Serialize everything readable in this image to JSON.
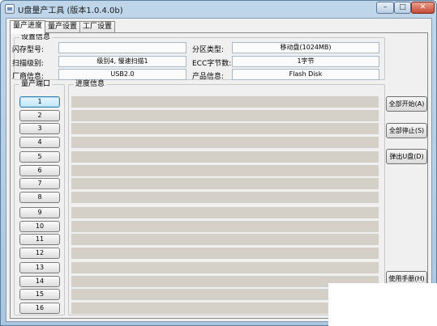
{
  "window": {
    "title": "U盘量产工具 (版本1.0.4.0b)",
    "controls": {
      "minimize": "–",
      "maximize": "□",
      "close": "✕"
    }
  },
  "tabs": [
    {
      "label": "量产进度"
    },
    {
      "label": "量产设置"
    },
    {
      "label": "工厂设置"
    }
  ],
  "settings": {
    "legend": "设置信息",
    "flash_model_label": "闪存型号:",
    "flash_model_value": "",
    "partition_type_label": "分区类型:",
    "partition_type_value": "移动盘(1024MB)",
    "scan_level_label": "扫描级别:",
    "scan_level_value": "级别4, 慢速扫描1",
    "ecc_label": "ECC字节数:",
    "ecc_value": "1字节",
    "vendor_label": "厂商信息:",
    "vendor_value": "USB2.0",
    "product_label": "产品信息:",
    "product_value": "Flash Disk"
  },
  "ports": {
    "legend": "量产端口",
    "items": [
      "1",
      "2",
      "3",
      "4",
      "5",
      "6",
      "7",
      "8",
      "9",
      "10",
      "11",
      "12",
      "13",
      "14",
      "15",
      "16"
    ],
    "active_index": 0
  },
  "progress": {
    "legend": "进度信息"
  },
  "side_buttons": {
    "start_all": "全部开始(A)",
    "stop_all": "全部停止(S)",
    "eject": "弹出U盘(D)",
    "manual": "使用手册(H)"
  }
}
